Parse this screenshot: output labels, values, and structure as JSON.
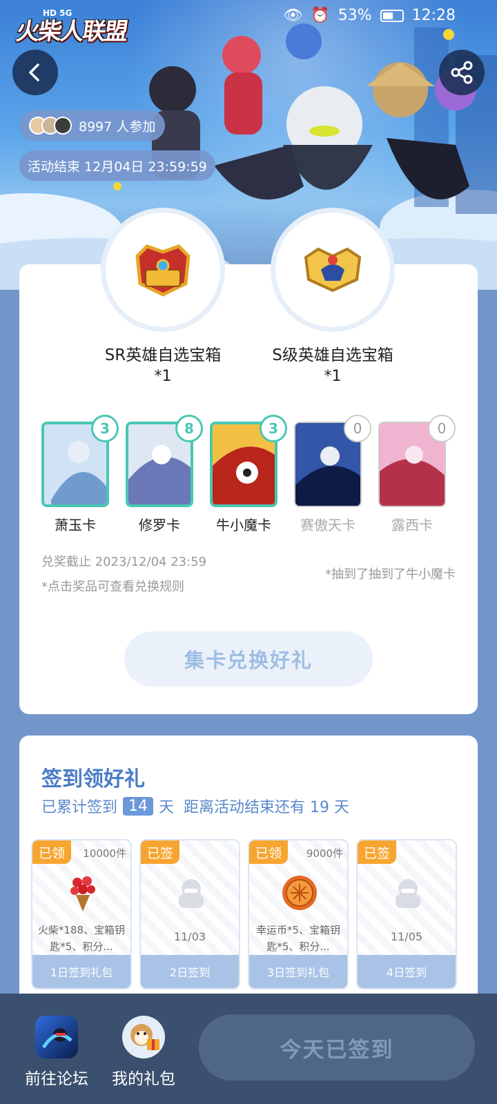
{
  "status_bar": {
    "network": "HD 5G",
    "battery": "53%",
    "time": "12:28"
  },
  "header": {
    "game_logo": "火柴人联盟",
    "participants": "8997 人参加",
    "end_time": "活动结束 12月04日 23:59:59"
  },
  "rewards": [
    {
      "name": "SR英雄自选宝箱",
      "qty": "*1"
    },
    {
      "name": "S级英雄自选宝箱",
      "qty": "*1"
    }
  ],
  "hero_cards": [
    {
      "label": "萧玉卡",
      "count": "3",
      "color1": "#cfe3f5",
      "color2": "#6f9ccc"
    },
    {
      "label": "修罗卡",
      "count": "8",
      "color1": "#dfe7f3",
      "color2": "#6a78b8"
    },
    {
      "label": "牛小魔卡",
      "count": "3",
      "color1": "#f2c143",
      "color2": "#b8261c"
    },
    {
      "label": "赛傲天卡",
      "count": "0",
      "color1": "#3356a8",
      "color2": "#0d1c45"
    },
    {
      "label": "露西卡",
      "count": "0",
      "color1": "#f0b3d0",
      "color2": "#b3324a"
    }
  ],
  "redeem": {
    "deadline": "兑奖截止 2023/12/04 23:59",
    "tip": "*点击奖品可查看兑换规则",
    "draw_note": "*抽到了抽到了牛小魔卡",
    "button": "集卡兑换好礼"
  },
  "signin": {
    "title": "签到领好礼",
    "prefix": "已累计签到",
    "days": "14",
    "suffix": "天",
    "remaining": "距离活动结束还有 19 天",
    "gifts": [
      {
        "tag": "已领",
        "stock": "10000件",
        "desc": "火柴*188、宝箱钥匙*5、积分...",
        "date": "",
        "footer": "1日签到礼包",
        "icon": "bouquet-icon"
      },
      {
        "tag": "已签",
        "stock": "",
        "desc": "",
        "date": "11/03",
        "footer": "2日签到",
        "icon": "placeholder-icon"
      },
      {
        "tag": "已领",
        "stock": "9000件",
        "desc": "幸运币*5、宝箱钥匙*5、积分...",
        "date": "",
        "footer": "3日签到礼包",
        "icon": "coin-icon"
      },
      {
        "tag": "已签",
        "stock": "",
        "desc": "",
        "date": "11/05",
        "footer": "4日签到",
        "icon": "placeholder-icon"
      }
    ]
  },
  "bottom_bar": {
    "forum": "前往论坛",
    "my_gifts": "我的礼包",
    "today_button": "今天已签到"
  }
}
